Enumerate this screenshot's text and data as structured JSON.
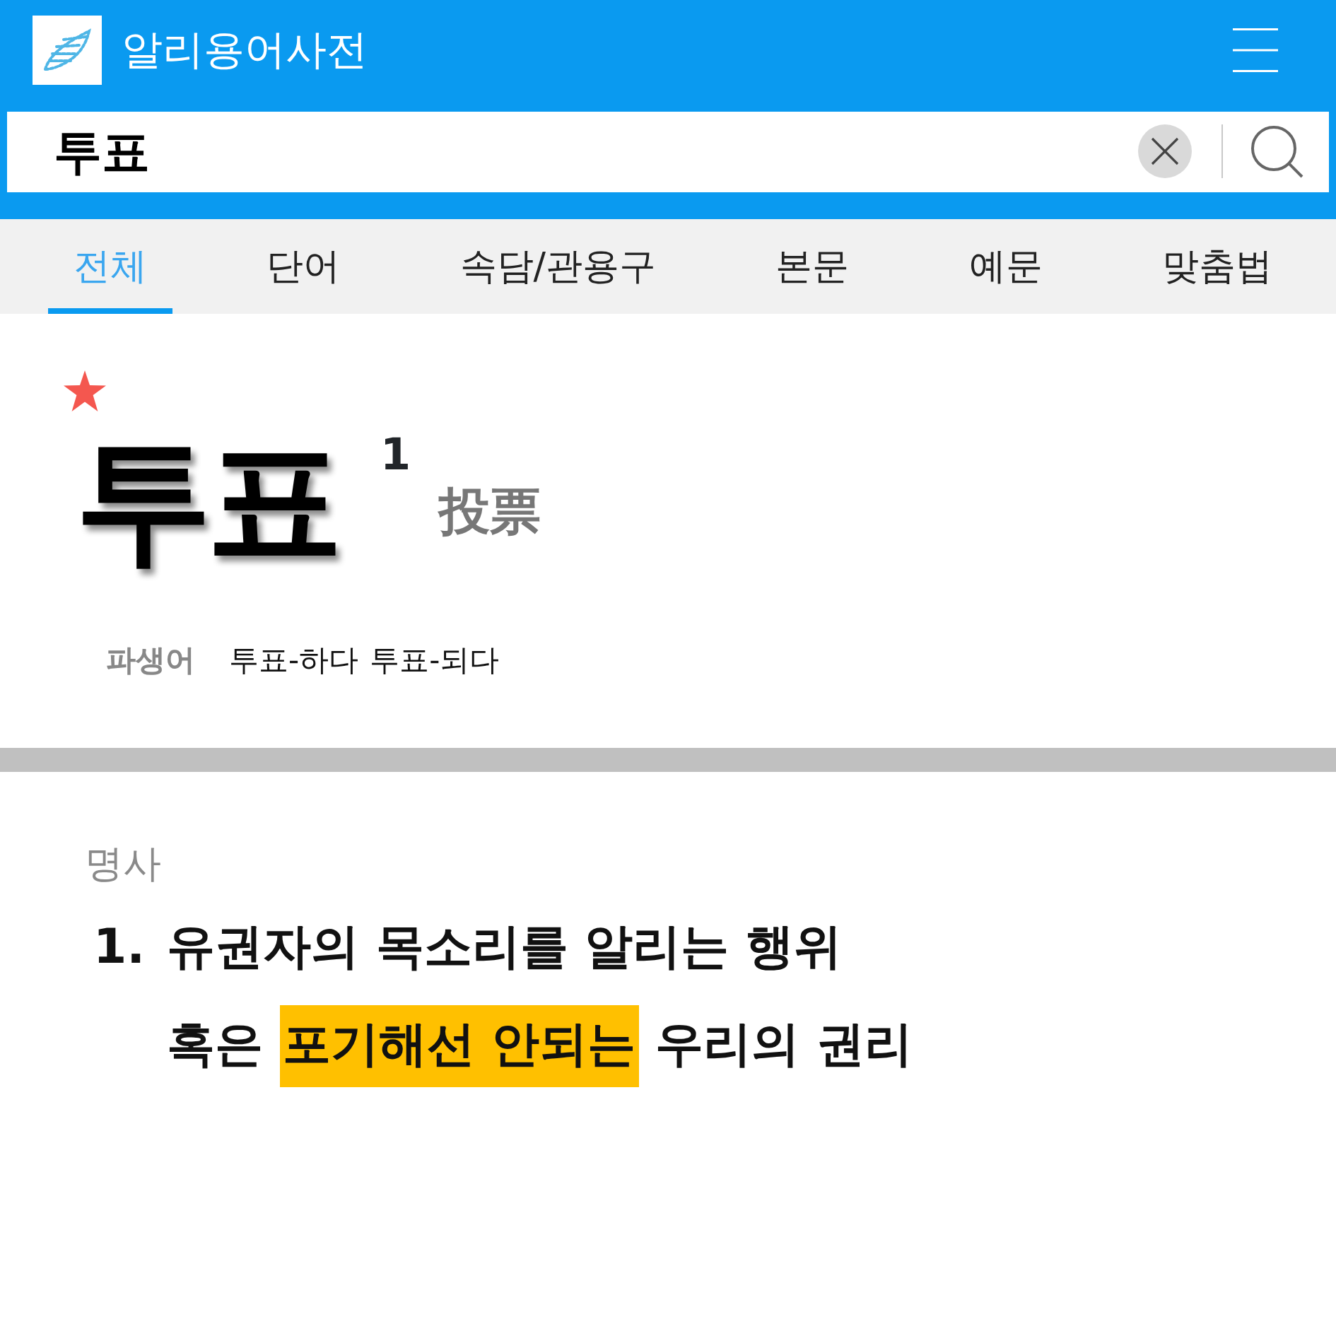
{
  "header": {
    "title": "알리용어사전"
  },
  "search": {
    "value": "투표"
  },
  "tabs": [
    {
      "label": "전체",
      "selected": true
    },
    {
      "label": "단어",
      "selected": false
    },
    {
      "label": "속담/관용구",
      "selected": false
    },
    {
      "label": "본문",
      "selected": false
    },
    {
      "label": "예문",
      "selected": false
    },
    {
      "label": "맞춤법",
      "selected": false
    }
  ],
  "entry": {
    "headword": "투표",
    "homograph_number": "1",
    "hanja": "投票",
    "derivatives_label": "파생어",
    "derivatives": [
      "투표-하다",
      "투표-되다"
    ]
  },
  "definitions": {
    "part_of_speech": "명사",
    "senses": [
      {
        "number": "1.",
        "lines": [
          [
            {
              "text": "유권자의 목소리를 알리는 행위",
              "highlighted": false
            }
          ],
          [
            {
              "text": "혹은",
              "highlighted": false
            },
            {
              "text": "포기해선 안되는",
              "highlighted": true
            },
            {
              "text": "우리의 권리",
              "highlighted": false
            }
          ]
        ]
      }
    ]
  }
}
